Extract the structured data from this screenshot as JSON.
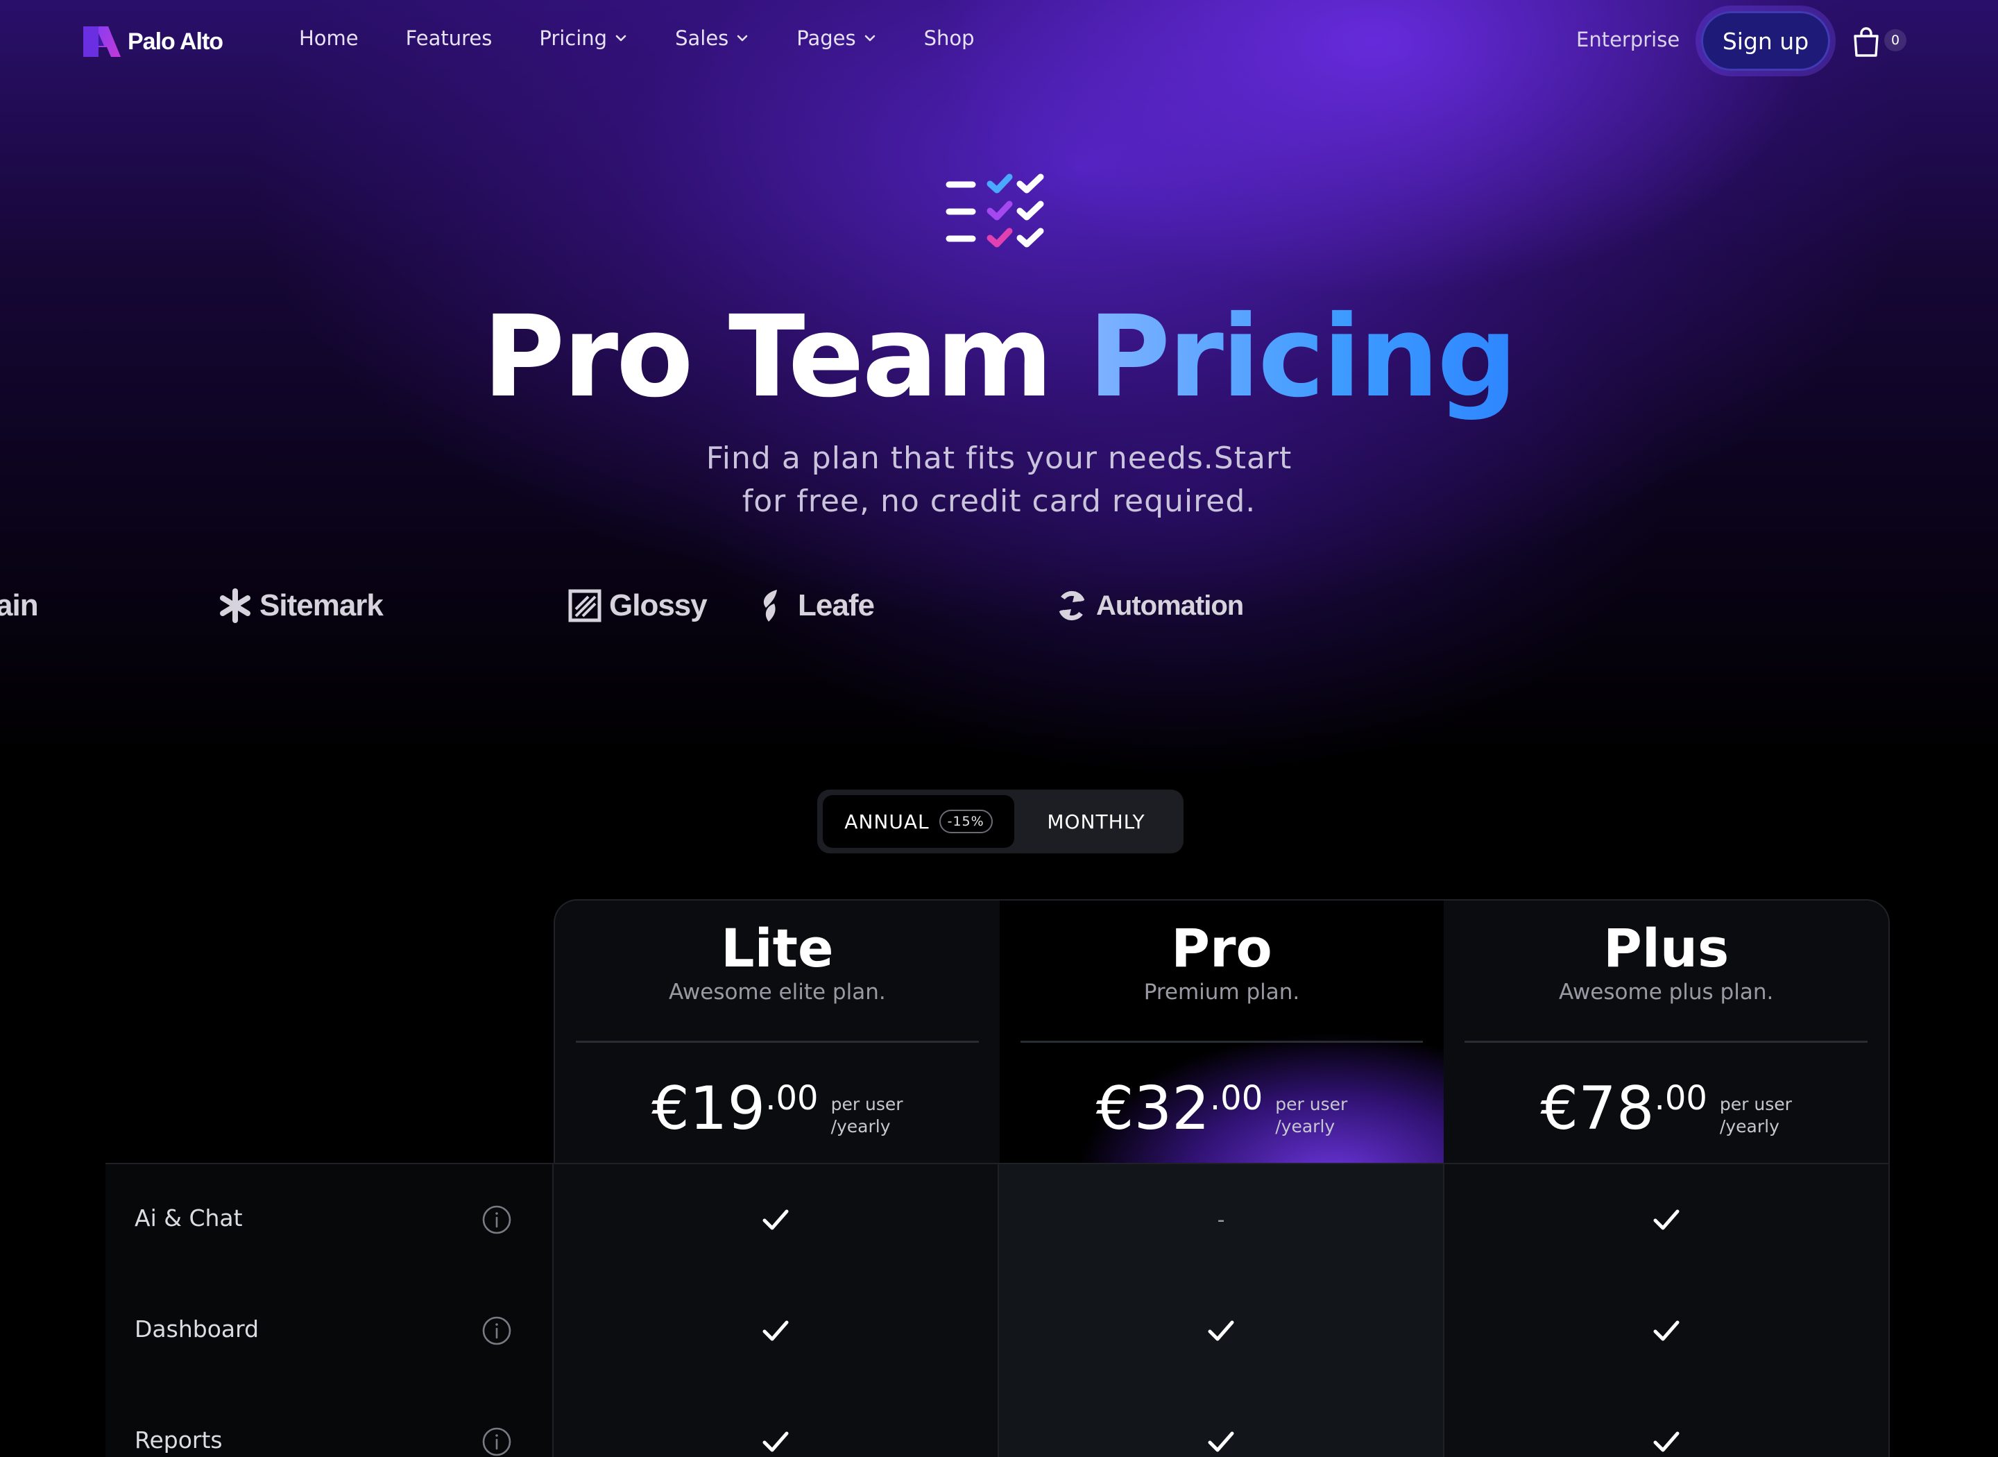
{
  "nav": {
    "brand": "Palo Alto",
    "links": [
      {
        "label": "Home",
        "dropdown": false
      },
      {
        "label": "Features",
        "dropdown": false
      },
      {
        "label": "Pricing",
        "dropdown": true
      },
      {
        "label": "Sales",
        "dropdown": true
      },
      {
        "label": "Pages",
        "dropdown": true
      },
      {
        "label": "Shop",
        "dropdown": false
      }
    ],
    "enterprise": "Enterprise",
    "signup": "Sign up",
    "cart_count": "0"
  },
  "hero": {
    "title_white": "Pro Team",
    "title_gradient": "Pricing",
    "subtitle_line1": "Find a plan that fits your needs.Start",
    "subtitle_line2": "for free, no credit card required."
  },
  "logos": [
    "ain",
    "Sitemark",
    "Glossy",
    "Leafe",
    "Automation"
  ],
  "billing_toggle": {
    "annual": "ANNUAL",
    "annual_badge": "-15%",
    "monthly": "MONTHLY",
    "selected": "annual"
  },
  "plans": [
    {
      "name": "Lite",
      "description": "Awesome elite plan.",
      "price": "€19",
      "cents": ".00",
      "unit_line1": "per user",
      "unit_line2": "/yearly"
    },
    {
      "name": "Pro",
      "description": "Premium plan.",
      "price": "€32",
      "cents": ".00",
      "unit_line1": "per user",
      "unit_line2": "/yearly"
    },
    {
      "name": "Plus",
      "description": "Awesome plus plan.",
      "price": "€78",
      "cents": ".00",
      "unit_line1": "per user",
      "unit_line2": "/yearly"
    }
  ],
  "features": [
    {
      "label": "Ai & Chat",
      "values": [
        "check",
        "-",
        "check"
      ]
    },
    {
      "label": "Dashboard",
      "values": [
        "check",
        "check",
        "check"
      ]
    },
    {
      "label": "Reports",
      "values": [
        "check",
        "check",
        "check"
      ]
    }
  ],
  "colors": {
    "accent_purple": "#6a2ee0",
    "gradient_blue": "#3d9bff",
    "signup_bg": "#1d1a78",
    "background": "#000000"
  },
  "icons": {
    "cart": "shopping-bag-icon",
    "info": "info-circle-icon",
    "check": "check-icon",
    "hero": "checklist-icon"
  }
}
